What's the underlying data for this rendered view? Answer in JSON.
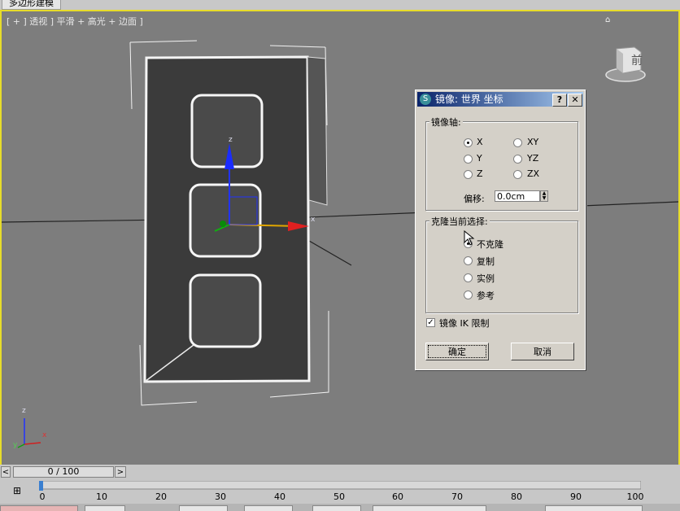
{
  "window": {
    "tab_title": "多边形建模"
  },
  "viewport": {
    "label": "[ + ] 透视 ] 平滑 + 高光 + 边面 ]",
    "axis_labels": {
      "x": "x",
      "y": "y",
      "z": "z"
    },
    "viewcube_label": "前",
    "accent_color": "#e7dc2a"
  },
  "dialog": {
    "title": "镜像: 世界 坐标",
    "help_label": "?",
    "close_label": "✕",
    "axis_group": {
      "legend": "镜像轴:",
      "options": [
        "X",
        "XY",
        "Y",
        "YZ",
        "Z",
        "ZX"
      ],
      "selected": "X",
      "offset_label": "偏移:",
      "offset_value": "0.0cm"
    },
    "clone_group": {
      "legend": "克隆当前选择:",
      "options": [
        "不克隆",
        "复制",
        "实例",
        "参考"
      ],
      "selected": "不克隆"
    },
    "ik_checkbox": {
      "label": "镜像 IK 限制",
      "checked": true
    },
    "ok_label": "确定",
    "cancel_label": "取消"
  },
  "timeline": {
    "frame_display": "0 / 100",
    "prev_label": "<",
    "next_label": ">",
    "ruler_labels": [
      "0",
      "10",
      "20",
      "30",
      "40",
      "50",
      "60",
      "70",
      "80",
      "90",
      "100"
    ]
  }
}
